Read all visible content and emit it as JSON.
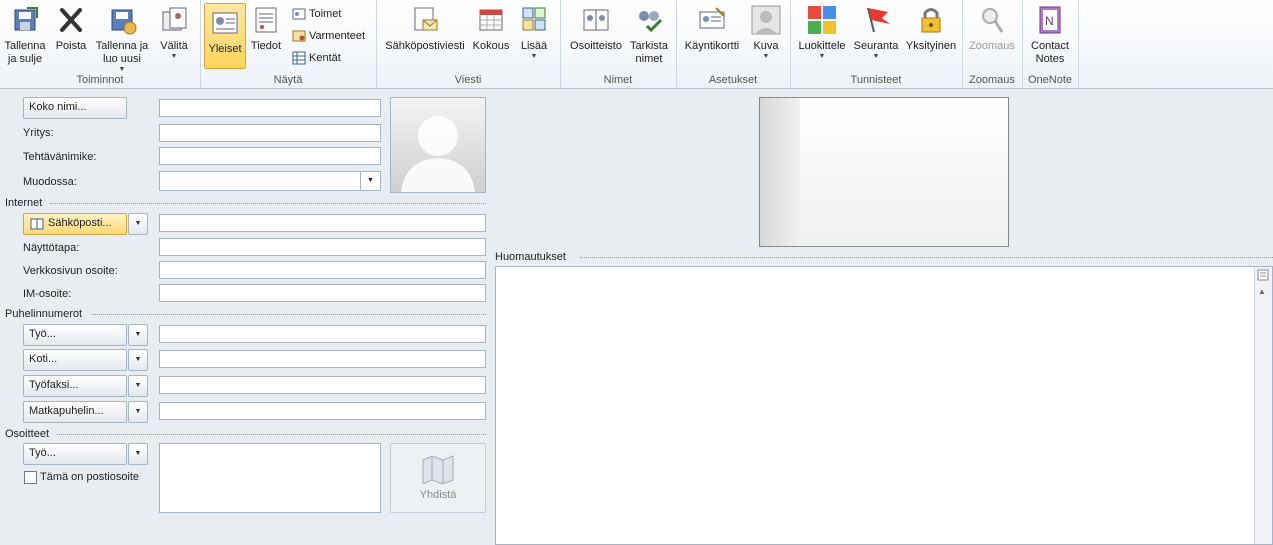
{
  "ribbon": {
    "groups": {
      "actions": "Toiminnot",
      "show": "Näytä",
      "message": "Viesti",
      "names": "Nimet",
      "settings": "Asetukset",
      "tags": "Tunnisteet",
      "zoom": "Zoomaus",
      "onenote": "OneNote"
    },
    "buttons": {
      "save_close": "Tallenna\nja sulje",
      "delete": "Poista",
      "save_new": "Tallenna ja\nluo uusi",
      "forward": "Välitä",
      "general": "Yleiset",
      "details": "Tiedot",
      "activities": "Toimet",
      "certificates": "Varmenteet",
      "fields": "Kentät",
      "email": "Sähköpostiviesti",
      "meeting": "Kokous",
      "more": "Lisää",
      "address_book": "Osoitteisto",
      "check_names": "Tarkista\nnimet",
      "business_card": "Käyntikortti",
      "picture": "Kuva",
      "categorize": "Luokittele",
      "follow_up": "Seuranta",
      "private": "Yksityinen",
      "zoom": "Zoomaus",
      "contact_notes": "Contact\nNotes"
    }
  },
  "form": {
    "full_name_btn": "Koko nimi...",
    "company_label": "Yritys:",
    "job_title_label": "Tehtävänimike:",
    "file_as_label": "Muodossa:",
    "internet_title": "Internet",
    "email_btn": "Sähköposti...",
    "display_as_label": "Näyttötapa:",
    "web_label": "Verkkosivun osoite:",
    "im_label": "IM-osoite:",
    "phones_title": "Puhelinnumerot",
    "phone_work": "Työ...",
    "phone_home": "Koti...",
    "phone_fax": "Työfaksi...",
    "phone_mobile": "Matkapuhelin...",
    "addresses_title": "Osoitteet",
    "address_work": "Työ...",
    "mailing_address": "Tämä on postiosoite",
    "map_btn": "Yhdistä",
    "notes_title": "Huomautukset"
  }
}
